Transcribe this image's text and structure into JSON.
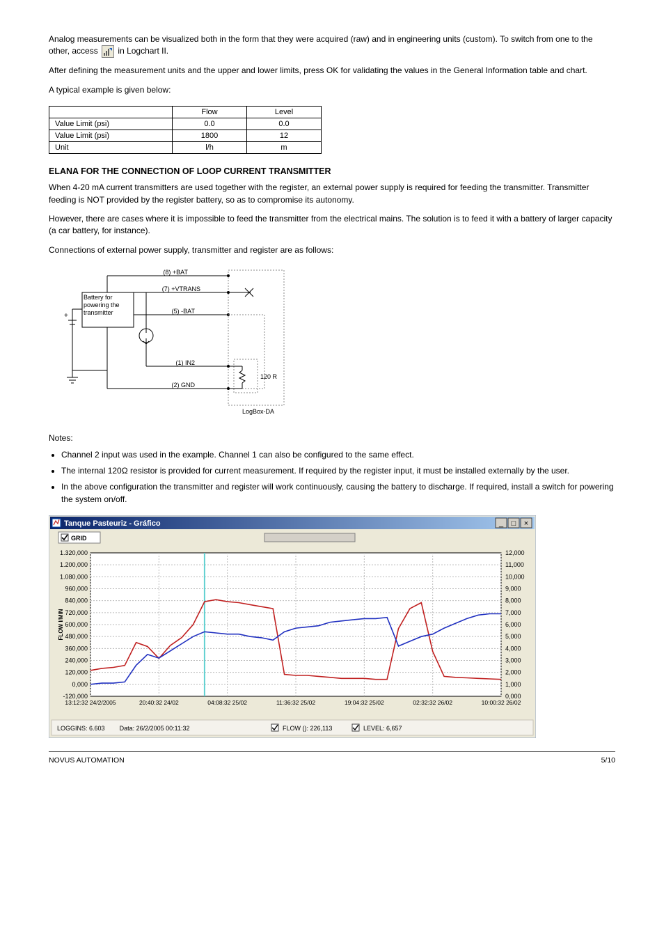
{
  "intro": {
    "p1_a": "Analog measurements can be visualized both in the form that they were acquired (raw) and in engineering units (custom). To switch from one to the other, access",
    "p1_b": "in Logchart II.",
    "p2": "After defining the measurement units and the upper and lower limits, press OK for validating the values in the General Information table and chart."
  },
  "table_caption": "A typical example is given below:",
  "table": {
    "headers": [
      "",
      "Flow",
      "Level"
    ],
    "rows": [
      [
        "Value Limit (psi)",
        "0.0",
        "0.0"
      ],
      [
        "Value Limit (psi)",
        "1800",
        "12"
      ],
      [
        "Unit",
        "l/h",
        "m"
      ]
    ]
  },
  "section_heading": "ELANA FOR THE CONNECTION OF LOOP CURRENT TRANSMITTER",
  "section": {
    "p1": "When 4-20 mA current transmitters are used together with the register, an external power supply is required for feeding the transmitter. Transmitter feeding is NOT provided by the register battery, so as to compromise its autonomy.",
    "p2": "However, there are cases where it is impossible to feed the transmitter from the electrical mains. The solution is to feed it with a battery of larger capacity (a car battery, for instance).",
    "p3": "Connections of external power supply, transmitter and register are as follows:",
    "notes_intro": "Notes:",
    "note1": "Channel 2 input was used in the example. Channel 1 can also be configured to the same effect.",
    "note2_a": "The internal 120",
    "note2_b": " resistor is provided for current measurement. If required by the register input, it must be installed externally by the user.",
    "note3": "In the above configuration the transmitter and register will work continuously, causing the battery to discharge. If required, install a switch for powering the system on/off."
  },
  "ohm_symbol": "Ω",
  "diagram": {
    "battery_label": "Battery for\npowering the\ntransmitter",
    "pin8": "(8) +BAT",
    "pin7": "(7) +VTRANS",
    "pin5": "(5) -BAT",
    "pin1": "(1) IN2",
    "pin2": "(2) GND",
    "resistor": "120 R",
    "device": "LogBox-DA"
  },
  "chart_data": {
    "type": "line",
    "title": "Tanque Pasteuriz - Gráfico",
    "toolbar_grid_label": "GRID",
    "x_ticks": [
      "13:12:32 24/2/2005",
      "20:40:32 24/02",
      "04:08:32 25/02",
      "11:36:32 25/02",
      "19:04:32 25/02",
      "02:32:32 26/02",
      "10:00:32 26/02"
    ],
    "left_axis": {
      "label": "FLOW l/MIN",
      "min": -120,
      "max": 1320,
      "step": 120
    },
    "right_axis": {
      "label": "",
      "min": 0,
      "max": 12,
      "step": 1
    },
    "series": [
      {
        "name": "FLOW ():",
        "color": "#c02020",
        "axis": "left",
        "values": [
          140,
          160,
          170,
          190,
          420,
          380,
          260,
          390,
          470,
          600,
          830,
          850,
          830,
          820,
          800,
          780,
          760,
          100,
          90,
          90,
          80,
          70,
          60,
          60,
          60,
          50,
          50,
          560,
          760,
          820,
          330,
          80,
          70,
          65,
          60,
          55,
          50
        ]
      },
      {
        "name": "LEVEL:",
        "color": "#2030c0",
        "axis": "right",
        "values": [
          1.0,
          1.1,
          1.1,
          1.2,
          2.6,
          3.5,
          3.2,
          3.8,
          4.4,
          5.0,
          5.4,
          5.3,
          5.2,
          5.2,
          5.0,
          4.9,
          4.7,
          5.4,
          5.7,
          5.8,
          5.9,
          6.2,
          6.3,
          6.4,
          6.5,
          6.5,
          6.6,
          4.2,
          4.6,
          5.0,
          5.2,
          5.7,
          6.1,
          6.5,
          6.8,
          6.9,
          6.9
        ]
      }
    ],
    "cursor_x_index": 10.0,
    "status": {
      "loggings_label": "LOGGINS:",
      "loggings": "6.603",
      "date_label": "Data:",
      "date": "26/2/2005 00:11:32",
      "flow_label": "FLOW ():",
      "flow": "226,113",
      "level_label": "LEVEL:",
      "level": "6,657"
    }
  },
  "footer": {
    "left": "NOVUS AUTOMATION",
    "right": "5/10"
  }
}
